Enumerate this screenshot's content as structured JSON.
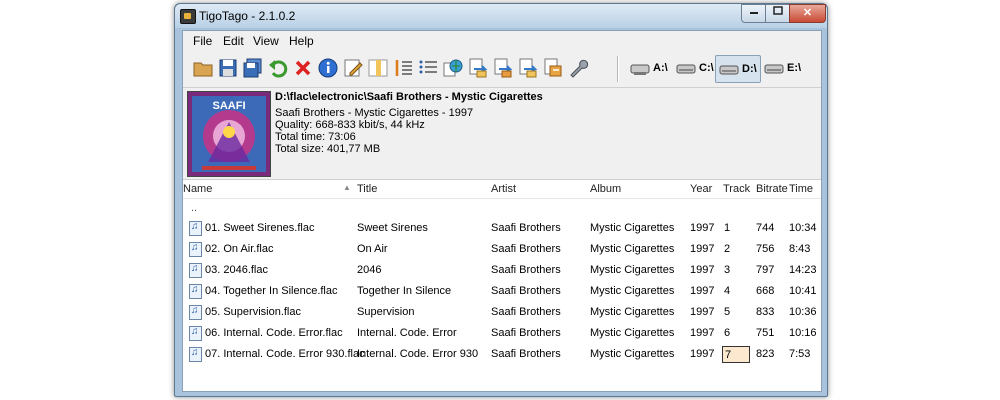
{
  "window": {
    "title": "TigoTago - 2.1.0.2"
  },
  "menu": [
    {
      "name": "menu-file",
      "label": "File"
    },
    {
      "name": "menu-edit",
      "label": "Edit"
    },
    {
      "name": "menu-view",
      "label": "View"
    },
    {
      "name": "menu-help",
      "label": "Help"
    }
  ],
  "toolbar": {
    "buttons": [
      {
        "name": "open-folder-button",
        "icon": "folder-icon"
      },
      {
        "name": "save-button",
        "icon": "floppy-icon"
      },
      {
        "name": "save-all-button",
        "icon": "floppy-multi-icon"
      },
      {
        "name": "undo-button",
        "icon": "undo-arrow-icon"
      },
      {
        "name": "remove-button",
        "icon": "red-x-icon"
      },
      {
        "name": "info-button",
        "icon": "info-icon"
      },
      {
        "name": "edit-tags-button",
        "icon": "pencil-page-icon"
      },
      {
        "name": "columns-button",
        "icon": "columns-icon"
      },
      {
        "name": "number-tracks-button",
        "icon": "numbered-list-icon"
      },
      {
        "name": "list-button",
        "icon": "list-icon"
      },
      {
        "name": "web-lookup-button",
        "icon": "globe-icon"
      },
      {
        "name": "tag-from-filename-button",
        "icon": "rename-icon"
      },
      {
        "name": "rename-files-button",
        "icon": "rename-icon"
      },
      {
        "name": "convert-button",
        "icon": "rename-icon"
      },
      {
        "name": "export-button",
        "icon": "rename-icon"
      },
      {
        "name": "settings-button",
        "icon": "wrench-icon"
      }
    ],
    "drives": [
      {
        "name": "drive-a",
        "label": "A:\\",
        "active": false
      },
      {
        "name": "drive-c",
        "label": "C:\\",
        "active": false
      },
      {
        "name": "drive-d",
        "label": "D:\\",
        "active": true
      },
      {
        "name": "drive-e",
        "label": "E:\\",
        "active": false
      }
    ]
  },
  "info": {
    "path": "D:\\flac\\electronic\\Saafi Brothers - Mystic Cigarettes",
    "album_line": "Saafi Brothers - Mystic Cigarettes - 1997",
    "quality": "Quality: 668-833 kbit/s, 44 kHz",
    "total_time": "Total time: 73:06",
    "total_size": "Total size: 401,77 MB",
    "cover_text": "SAAFI"
  },
  "columns": {
    "name": "Name",
    "title": "Title",
    "artist": "Artist",
    "album": "Album",
    "year": "Year",
    "track": "Track",
    "bitrate": "Bitrate",
    "time": "Time"
  },
  "parent_dir": "..",
  "rows": [
    {
      "name": "01. Sweet Sirenes.flac",
      "title": "Sweet Sirenes",
      "artist": "Saafi Brothers",
      "album": "Mystic Cigarettes",
      "year": "1997",
      "track": "1",
      "bitrate": "744",
      "time": "10:34"
    },
    {
      "name": "02. On Air.flac",
      "title": "On Air",
      "artist": "Saafi Brothers",
      "album": "Mystic Cigarettes",
      "year": "1997",
      "track": "2",
      "bitrate": "756",
      "time": "8:43"
    },
    {
      "name": "03. 2046.flac",
      "title": "2046",
      "artist": "Saafi Brothers",
      "album": "Mystic Cigarettes",
      "year": "1997",
      "track": "3",
      "bitrate": "797",
      "time": "14:23"
    },
    {
      "name": "04. Together In Silence.flac",
      "title": "Together In Silence",
      "artist": "Saafi Brothers",
      "album": "Mystic Cigarettes",
      "year": "1997",
      "track": "4",
      "bitrate": "668",
      "time": "10:41"
    },
    {
      "name": "05. Supervision.flac",
      "title": "Supervision",
      "artist": "Saafi Brothers",
      "album": "Mystic Cigarettes",
      "year": "1997",
      "track": "5",
      "bitrate": "833",
      "time": "10:36"
    },
    {
      "name": "06. Internal. Code. Error.flac",
      "title": "Internal. Code. Error",
      "artist": "Saafi Brothers",
      "album": "Mystic Cigarettes",
      "year": "1997",
      "track": "6",
      "bitrate": "751",
      "time": "10:16"
    },
    {
      "name": "07. Internal. Code. Error 930.flac",
      "title": "Internal. Code. Error 930",
      "artist": "Saafi Brothers",
      "album": "Mystic Cigarettes",
      "year": "1997",
      "track": "7",
      "bitrate": "823",
      "time": "7:53"
    }
  ],
  "editing": {
    "track_value": "7"
  }
}
